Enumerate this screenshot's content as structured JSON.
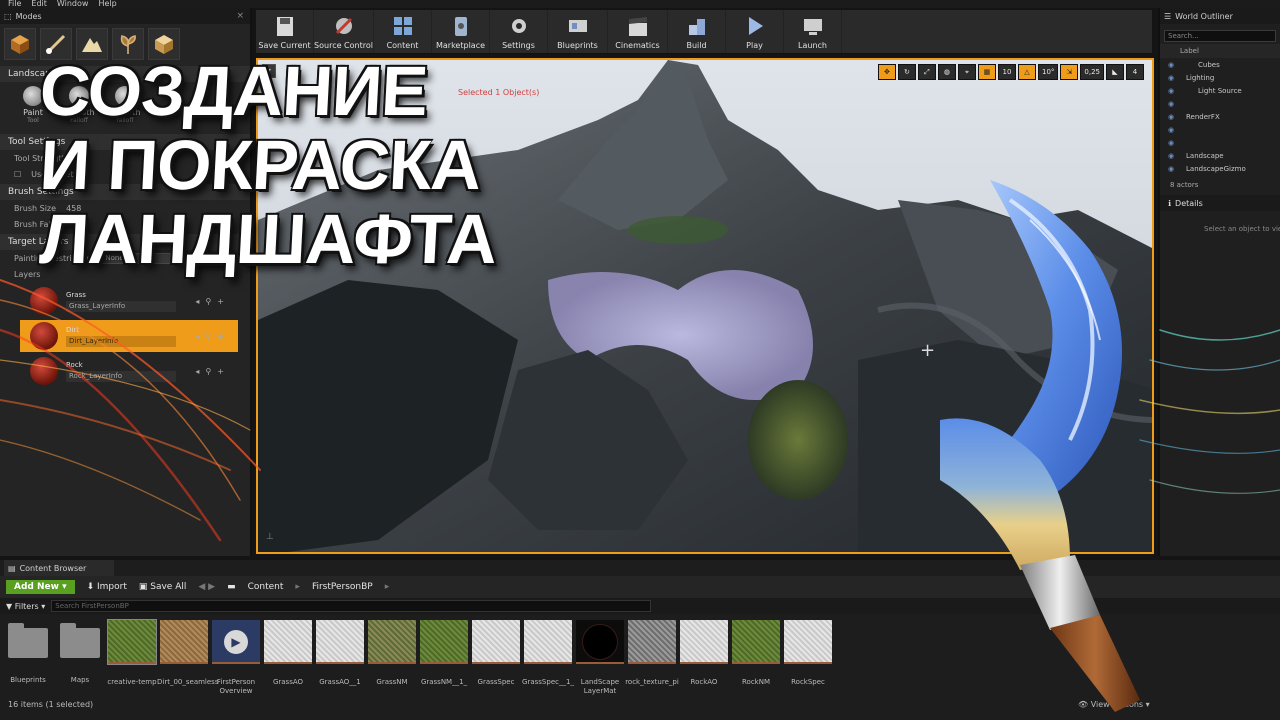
{
  "menu": [
    "File",
    "Edit",
    "Window",
    "Help"
  ],
  "modes_panel": {
    "tab_label": "Modes",
    "landscape_editor_label": "Landscape Editor",
    "tools": [
      {
        "label": "Paint",
        "sub": "Tool"
      },
      {
        "label": "Smooth",
        "sub": "Falloff"
      },
      {
        "label": "Smooth",
        "sub": "falloff"
      }
    ],
    "tool_settings_label": "Tool Settings",
    "tool_strength_label": "Tool Strength",
    "use_target_label": "Use Target",
    "brush_settings_label": "Brush Settings",
    "brush_size_label": "Brush Size",
    "brush_size_value": "458",
    "brush_falloff_label": "Brush Falloff",
    "target_layers_label": "Target Layers",
    "painting_restriction_label": "Painting Restriction",
    "painting_restriction_value": "None",
    "layers_label": "Layers",
    "layers": [
      {
        "name": "Grass",
        "info": "Grass_LayerInfo"
      },
      {
        "name": "Dirt",
        "info": "Dirt_LayerInfo"
      },
      {
        "name": "Rock",
        "info": "Rock_LayerInfo"
      }
    ]
  },
  "toolbar": {
    "save_current": "Save Current",
    "source_control": "Source Control",
    "content": "Content",
    "marketplace": "Marketplace",
    "settings": "Settings",
    "blueprints": "Blueprints",
    "cinematics": "Cinematics",
    "build": "Build",
    "play": "Play",
    "launch": "Launch"
  },
  "viewport": {
    "selected_note": "Selected 1 Object(s)",
    "snap_translate": "10",
    "snap_rotate": "10°",
    "snap_scale": "0,25",
    "camera_speed": "4"
  },
  "outliner": {
    "title": "World Outliner",
    "search_placeholder": "Search...",
    "label_col": "Label",
    "items": [
      {
        "label": "Cubes"
      },
      {
        "label": "Lighting"
      },
      {
        "label": "Light Source"
      },
      {
        "label": "RenderFX"
      },
      {
        "label": "Landscape"
      },
      {
        "label": "LandscapeGizmo"
      }
    ],
    "actor_count": "8 actors",
    "details_title": "Details",
    "details_message": "Select an object to view details."
  },
  "content_browser": {
    "tab_label": "Content Browser",
    "add_new": "Add New",
    "import": "Import",
    "save_all": "Save All",
    "path": [
      "Content",
      "FirstPersonBP"
    ],
    "filters": "Filters",
    "search_placeholder": "Search FirstPersonBP",
    "assets": [
      {
        "name": "Blueprints",
        "kind": "folder"
      },
      {
        "name": "Maps",
        "kind": "folder"
      },
      {
        "name": "creative-temp",
        "kind": "grass"
      },
      {
        "name": "Dirt_00_seamless",
        "kind": "dirt"
      },
      {
        "name": "FirstPerson Overview",
        "kind": "overview"
      },
      {
        "name": "GrassAO",
        "kind": "white"
      },
      {
        "name": "GrassAO__1",
        "kind": "white"
      },
      {
        "name": "GrassNM",
        "kind": "grassnm"
      },
      {
        "name": "GrassNM__1_",
        "kind": "grass"
      },
      {
        "name": "GrassSpec",
        "kind": "white"
      },
      {
        "name": "GrassSpec__1_",
        "kind": "white"
      },
      {
        "name": "LandScape LayerMat",
        "kind": "sphere"
      },
      {
        "name": "rock_texture_pi",
        "kind": "rock"
      },
      {
        "name": "RockAO",
        "kind": "white"
      },
      {
        "name": "RockNM",
        "kind": "grass"
      },
      {
        "name": "RockSpec",
        "kind": "white"
      }
    ],
    "status": "16 items (1 selected)",
    "view_options": "View Options"
  },
  "overlay": {
    "title_lines": [
      "СОЗДАНИЕ",
      "И ПОКРАСКА",
      "ЛАНДШАФТА"
    ]
  },
  "colors": {
    "selection_orange": "#ef9c1a",
    "add_new_green": "#5aa020",
    "brush_paint_blue": "#5b8de8"
  }
}
